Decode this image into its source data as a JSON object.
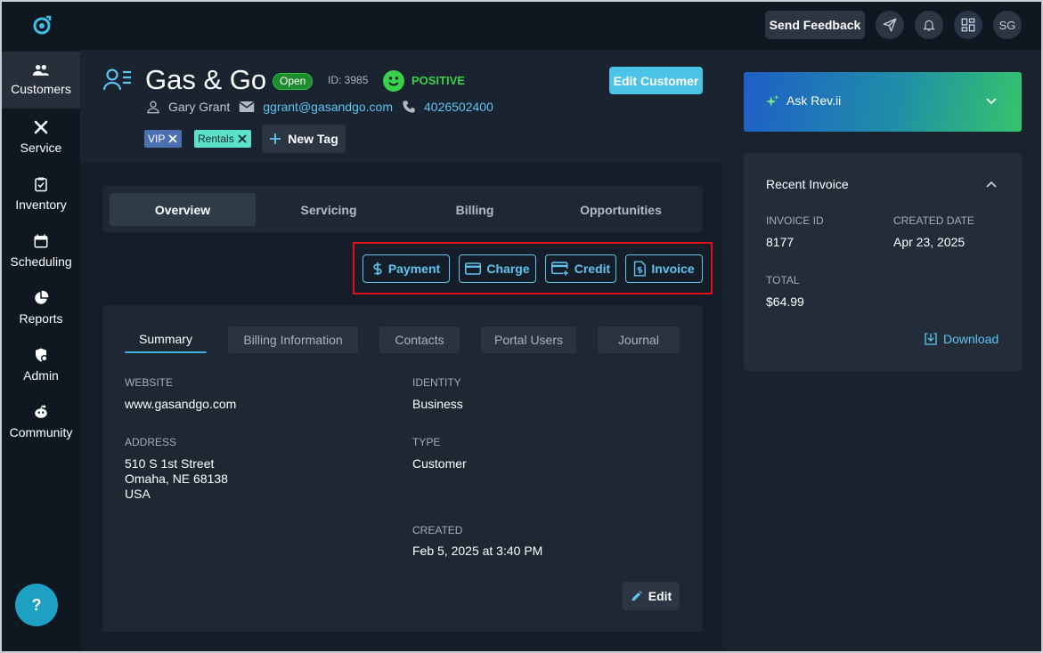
{
  "topbar": {
    "feedback_label": "Send Feedback",
    "avatar_initials": "SG"
  },
  "sidebar": {
    "items": [
      {
        "label": "Customers",
        "icon": "users-icon"
      },
      {
        "label": "Service",
        "icon": "tools-icon"
      },
      {
        "label": "Inventory",
        "icon": "clipboard-check-icon"
      },
      {
        "label": "Scheduling",
        "icon": "calendar-icon"
      },
      {
        "label": "Reports",
        "icon": "pie-chart-icon"
      },
      {
        "label": "Admin",
        "icon": "shield-user-icon"
      },
      {
        "label": "Community",
        "icon": "community-icon"
      }
    ],
    "help_label": "?"
  },
  "customer": {
    "name": "Gas & Go",
    "status": "Open",
    "id_text": "ID: 3985",
    "sentiment": "POSITIVE",
    "edit_label": "Edit Customer",
    "contact_name": "Gary Grant",
    "email": "ggrant@gasandgo.com",
    "phone": "4026502400",
    "tags": [
      "VIP",
      "Rentals"
    ],
    "new_tag_label": "New Tag"
  },
  "tabs": [
    "Overview",
    "Servicing",
    "Billing",
    "Opportunities"
  ],
  "actions": [
    "Payment",
    "Charge",
    "Credit",
    "Invoice"
  ],
  "summary": {
    "subtabs": [
      "Summary",
      "Billing Information",
      "Contacts",
      "Portal Users",
      "Journal"
    ],
    "website_label": "WEBSITE",
    "website": "www.gasandgo.com",
    "identity_label": "IDENTITY",
    "identity": "Business",
    "address_label": "ADDRESS",
    "address_line1": "510 S 1st Street",
    "address_line2": "Omaha, NE 68138",
    "address_line3": "USA",
    "type_label": "TYPE",
    "type": "Customer",
    "created_label": "CREATED",
    "created": "Feb 5, 2025 at 3:40 PM",
    "edit_label": "Edit"
  },
  "right_panel": {
    "ask_label": "Ask Rev.ii",
    "invoice_title": "Recent Invoice",
    "invoice_id_label": "INVOICE ID",
    "invoice_id": "8177",
    "created_date_label": "CREATED DATE",
    "created_date": "Apr 23, 2025",
    "total_label": "TOTAL",
    "total": "$64.99",
    "download_label": "Download"
  },
  "colors": {
    "accent": "#5fc4ef",
    "positive": "#3ad14a",
    "highlight_frame": "#e3101b"
  }
}
